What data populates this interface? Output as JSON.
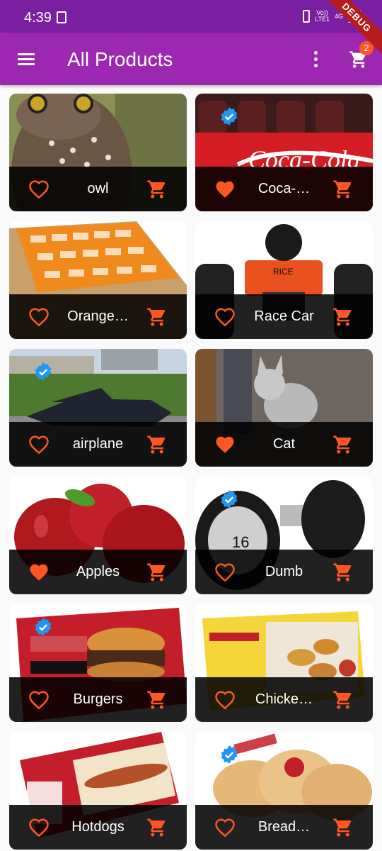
{
  "status_bar": {
    "time": "4:39",
    "net_top": "Vo))",
    "net_bottom": "LTE1",
    "net_gen": "4G"
  },
  "debug_label": "DEBUG",
  "app_bar": {
    "title": "All Products",
    "cart_count": "2"
  },
  "colors": {
    "app_bar": "#9c27b0",
    "status_bar": "#7b1fa2",
    "accent": "#ff5722",
    "verified": "#2196f3"
  },
  "products": [
    {
      "title": "owl",
      "favorite": false,
      "verified": false
    },
    {
      "title": "Coca-…",
      "favorite": true,
      "verified": true
    },
    {
      "title": "Orange…",
      "favorite": false,
      "verified": false
    },
    {
      "title": "Race Car",
      "favorite": false,
      "verified": false
    },
    {
      "title": "airplane",
      "favorite": false,
      "verified": true
    },
    {
      "title": "Cat",
      "favorite": true,
      "verified": false
    },
    {
      "title": "Apples",
      "favorite": true,
      "verified": false
    },
    {
      "title": "Dumb",
      "favorite": false,
      "verified": true
    },
    {
      "title": "Burgers",
      "favorite": false,
      "verified": true
    },
    {
      "title": "Chicke…",
      "favorite": false,
      "verified": false
    },
    {
      "title": "Hotdogs",
      "favorite": false,
      "verified": false
    },
    {
      "title": "Bread…",
      "favorite": false,
      "verified": true
    }
  ]
}
